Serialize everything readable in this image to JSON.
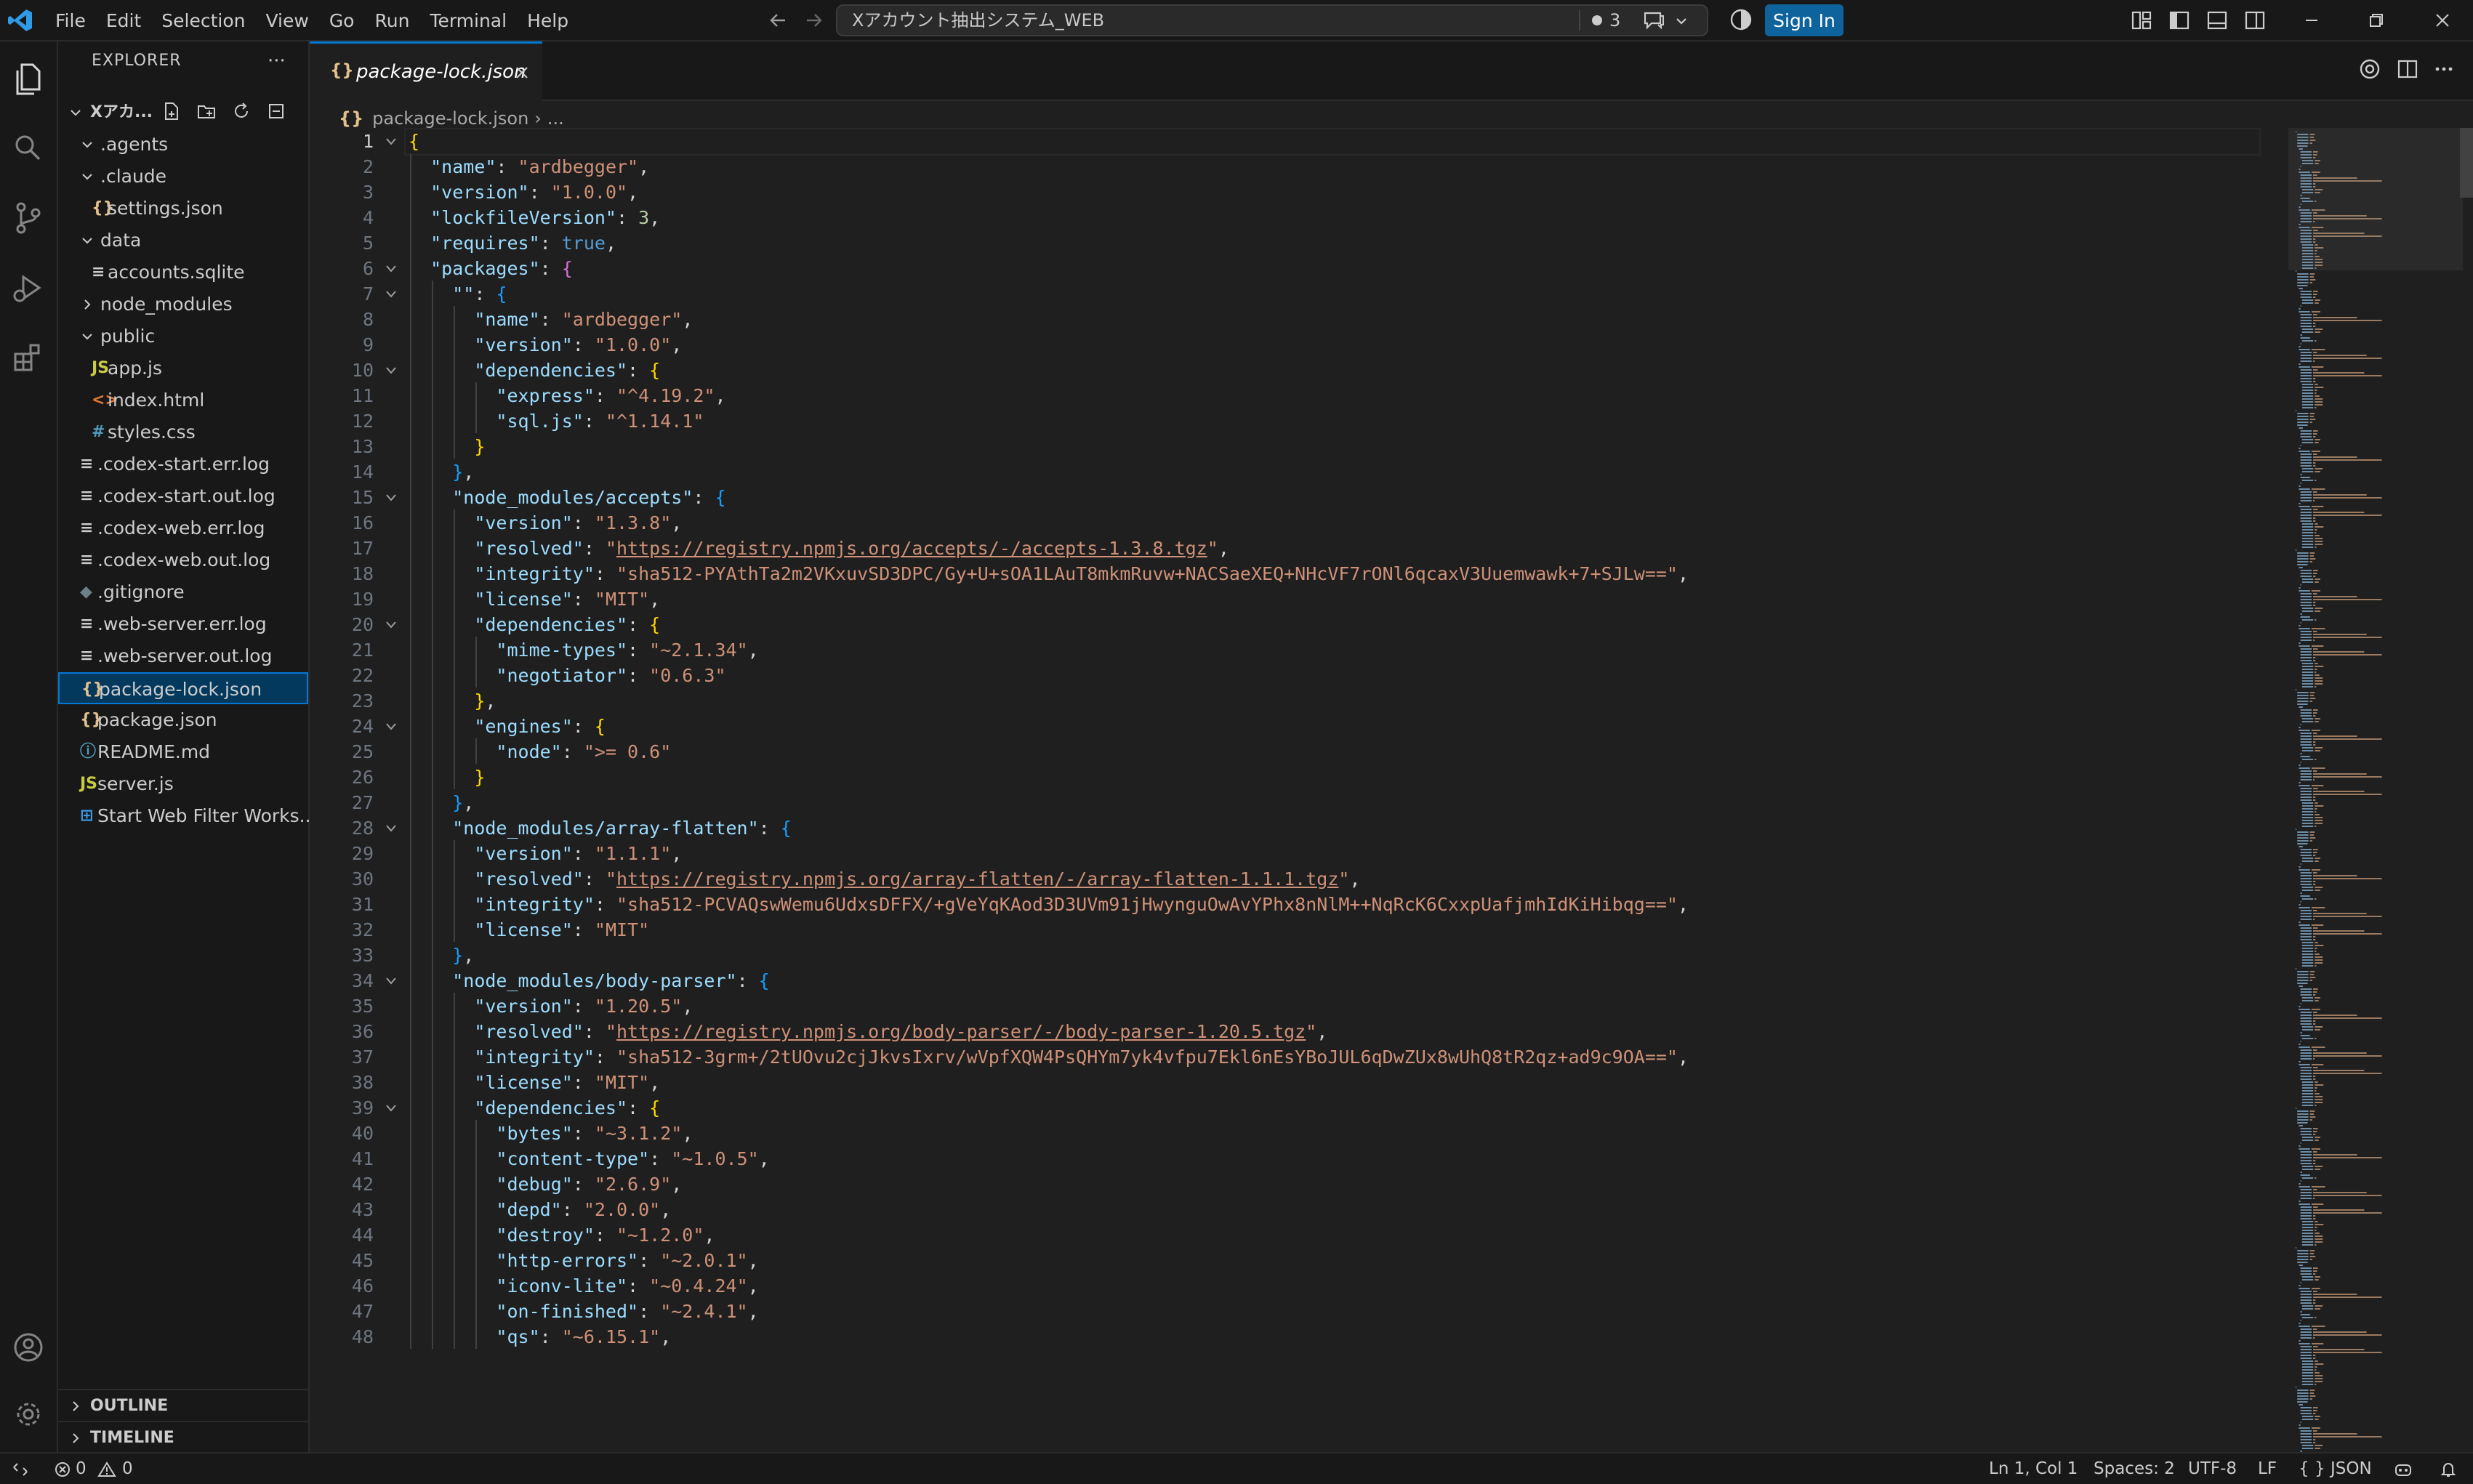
{
  "menu": [
    "File",
    "Edit",
    "Selection",
    "View",
    "Go",
    "Run",
    "Terminal",
    "Help"
  ],
  "command_center": {
    "title": "Xアカウント抽出システム_WEB",
    "changes_count": "3"
  },
  "sign_in": "Sign In",
  "explorer": {
    "title": "EXPLORER",
    "more": "···",
    "workspace": "Xアカ...",
    "items": [
      {
        "label": ".agents",
        "type": "folder",
        "expanded": true,
        "depth": 1
      },
      {
        "label": ".claude",
        "type": "folder",
        "expanded": true,
        "depth": 1
      },
      {
        "label": "settings.json",
        "type": "json",
        "icon": "{}",
        "depth": 2
      },
      {
        "label": "data",
        "type": "folder",
        "expanded": true,
        "depth": 1
      },
      {
        "label": "accounts.sqlite",
        "type": "file",
        "icon": "≡",
        "depth": 2
      },
      {
        "label": "node_modules",
        "type": "folder",
        "expanded": false,
        "depth": 1
      },
      {
        "label": "public",
        "type": "folder",
        "expanded": true,
        "depth": 1
      },
      {
        "label": "app.js",
        "type": "js",
        "icon": "JS",
        "depth": 2
      },
      {
        "label": "index.html",
        "type": "html",
        "icon": "<>",
        "depth": 2
      },
      {
        "label": "styles.css",
        "type": "css",
        "icon": "#",
        "depth": 2
      },
      {
        "label": ".codex-start.err.log",
        "type": "file",
        "icon": "≡",
        "depth": 1
      },
      {
        "label": ".codex-start.out.log",
        "type": "file",
        "icon": "≡",
        "depth": 1
      },
      {
        "label": ".codex-web.err.log",
        "type": "file",
        "icon": "≡",
        "depth": 1
      },
      {
        "label": ".codex-web.out.log",
        "type": "file",
        "icon": "≡",
        "depth": 1
      },
      {
        "label": ".gitignore",
        "type": "git",
        "icon": "◆",
        "depth": 1
      },
      {
        "label": ".web-server.err.log",
        "type": "file",
        "icon": "≡",
        "depth": 1
      },
      {
        "label": ".web-server.out.log",
        "type": "file",
        "icon": "≡",
        "depth": 1
      },
      {
        "label": "package-lock.json",
        "type": "json",
        "icon": "{}",
        "depth": 1,
        "selected": true
      },
      {
        "label": "package.json",
        "type": "json",
        "icon": "{}",
        "depth": 1
      },
      {
        "label": "README.md",
        "type": "info",
        "icon": "ⓘ",
        "depth": 1
      },
      {
        "label": "server.js",
        "type": "js",
        "icon": "JS",
        "depth": 1
      },
      {
        "label": "Start Web Filter Works...",
        "type": "win",
        "icon": "⊞",
        "depth": 1
      }
    ],
    "sections": [
      "OUTLINE",
      "TIMELINE"
    ]
  },
  "editor": {
    "tab_label": "package-lock.json",
    "tab_icon": "{}",
    "breadcrumb": "package-lock.json",
    "breadcrumb_tail": "...",
    "lines": [
      "{",
      "  \"name\": \"ardbegger\",",
      "  \"version\": \"1.0.0\",",
      "  \"lockfileVersion\": 3,",
      "  \"requires\": true,",
      "  \"packages\": {",
      "    \"\": {",
      "      \"name\": \"ardbegger\",",
      "      \"version\": \"1.0.0\",",
      "      \"dependencies\": {",
      "        \"express\": \"^4.19.2\",",
      "        \"sql.js\": \"^1.14.1\"",
      "      }",
      "    },",
      "    \"node_modules/accepts\": {",
      "      \"version\": \"1.3.8\",",
      "      \"resolved\": \"https://registry.npmjs.org/accepts/-/accepts-1.3.8.tgz\",",
      "      \"integrity\": \"sha512-PYAthTa2m2VKxuvSD3DPC/Gy+U+sOA1LAuT8mkmRuvw+NACSaeXEQ+NHcVF7rONl6qcaxV3Uuemwawk+7+SJLw==\",",
      "      \"license\": \"MIT\",",
      "      \"dependencies\": {",
      "        \"mime-types\": \"~2.1.34\",",
      "        \"negotiator\": \"0.6.3\"",
      "      },",
      "      \"engines\": {",
      "        \"node\": \">= 0.6\"",
      "      }",
      "    },",
      "    \"node_modules/array-flatten\": {",
      "      \"version\": \"1.1.1\",",
      "      \"resolved\": \"https://registry.npmjs.org/array-flatten/-/array-flatten-1.1.1.tgz\",",
      "      \"integrity\": \"sha512-PCVAQswWemu6UdxsDFFX/+gVeYqKAod3D3UVm91jHwynguOwAvYPhx8nNlM++NqRcK6CxxpUafjmhIdKiHibqg==\",",
      "      \"license\": \"MIT\"",
      "    },",
      "    \"node_modules/body-parser\": {",
      "      \"version\": \"1.20.5\",",
      "      \"resolved\": \"https://registry.npmjs.org/body-parser/-/body-parser-1.20.5.tgz\",",
      "      \"integrity\": \"sha512-3grm+/2tUOvu2cjJkvsIxrv/wVpfXQW4PsQHYm7yk4vfpu7Ekl6nEsYBoJUL6qDwZUx8wUhQ8tR2qz+ad9c9OA==\",",
      "      \"license\": \"MIT\",",
      "      \"dependencies\": {",
      "        \"bytes\": \"~3.1.2\",",
      "        \"content-type\": \"~1.0.5\",",
      "        \"debug\": \"2.6.9\",",
      "        \"depd\": \"2.0.0\",",
      "        \"destroy\": \"~1.2.0\",",
      "        \"http-errors\": \"~2.0.1\",",
      "        \"iconv-lite\": \"~0.4.24\",",
      "        \"on-finished\": \"~2.4.1\",",
      "        \"qs\": \"~6.15.1\","
    ],
    "folded_open_lines": [
      1,
      6,
      7,
      10,
      15,
      20,
      24,
      28,
      34,
      39
    ]
  },
  "status": {
    "errors": "0",
    "warnings": "0",
    "position": "Ln 1, Col 1",
    "indent": "Spaces: 2",
    "encoding": "UTF-8",
    "eol": "LF",
    "language": "JSON",
    "language_icon": "{ }"
  },
  "colors": {
    "accent": "#0078d4",
    "signin_bg": "#0e639c",
    "json_key": "#9cdcfe",
    "json_string": "#ce9178",
    "json_number": "#b5cea8",
    "json_bool": "#569cd6",
    "json_icon": "#e2c08d",
    "js_icon": "#cbcb41",
    "html_icon": "#e37933",
    "css_icon": "#519aba"
  }
}
